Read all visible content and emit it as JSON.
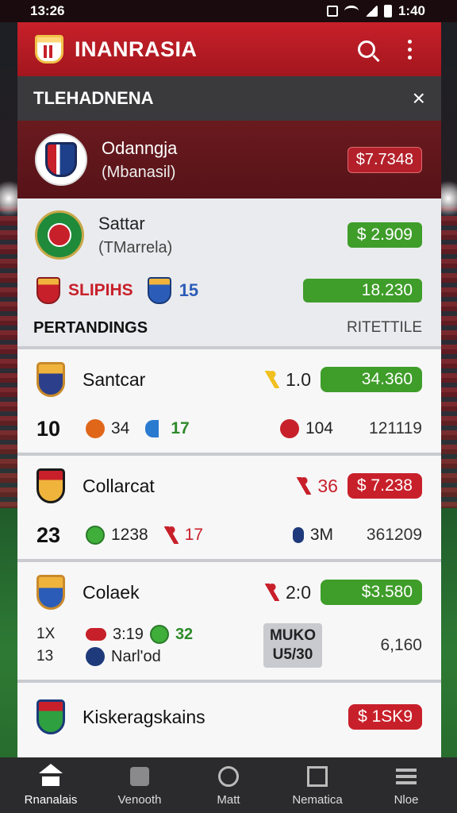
{
  "status_bar": {
    "time": "13:26",
    "right_time": "1:40"
  },
  "app": {
    "title": "INANRASIA"
  },
  "band": {
    "title": "TLEHADNENA",
    "close": "×"
  },
  "featured": {
    "name": "Odanngja",
    "sub": "(Mbanasil)",
    "price": "$7.7348"
  },
  "match_top": {
    "name": "Sattar",
    "sub": "(TMarrela)",
    "price": "$ 2.909"
  },
  "slips": {
    "label": "SLIPIHS",
    "count": "15",
    "bar_value": "18.230"
  },
  "standings": {
    "title": "PERTANDINGS",
    "right": "RITETTILE"
  },
  "rows": [
    {
      "team": "Santcar",
      "score": "1.0",
      "pill": "34.360",
      "big": "10",
      "stat1": "34",
      "stat2": "17",
      "mid": "104",
      "right": "121119"
    },
    {
      "team": "Collarcat",
      "score": "36",
      "pill": "$ 7.238",
      "big": "23",
      "stat1": "1238",
      "stat2": "17",
      "mid": "3M",
      "right": "361209"
    },
    {
      "team": "Colaek",
      "score": "2:0",
      "pill": "$3.580",
      "small_top": "1X",
      "small_bot": "13",
      "stat1": "3:19",
      "stat2": "32",
      "stat3": "Narl'od",
      "box_top": "MUKO",
      "box_bot": "U5/30",
      "right": "6,160"
    },
    {
      "team": "Kiskeragskains",
      "pill": "$ 1SK9"
    }
  ],
  "nav": [
    {
      "label": "Rnanalais",
      "icon": "home-icon"
    },
    {
      "label": "Venooth",
      "icon": "video-icon"
    },
    {
      "label": "Matt",
      "icon": "match-icon"
    },
    {
      "label": "Nematica",
      "icon": "news-icon"
    },
    {
      "label": "Nloe",
      "icon": "more-icon"
    }
  ],
  "colors": {
    "primary_red": "#c8202a",
    "green": "#3f9d2a",
    "dark_band": "#3a3a3c"
  }
}
